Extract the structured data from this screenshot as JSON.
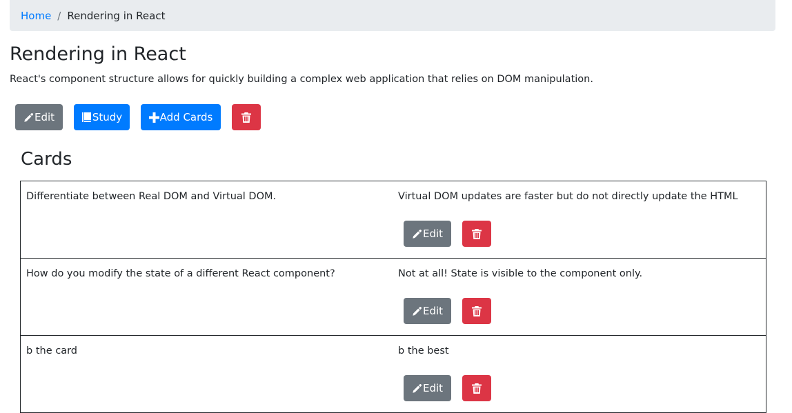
{
  "breadcrumb": {
    "home": "Home",
    "separator": "/",
    "current": "Rendering in React"
  },
  "deck": {
    "title": "Rendering in React",
    "description": "React's component structure allows for quickly building a complex web application that relies on DOM manipulation."
  },
  "toolbar": {
    "edit_label": "Edit",
    "edit_icon": "pencil-icon",
    "study_label": "Study",
    "study_icon": "book-icon",
    "add_label": "Add Cards",
    "add_icon": "plus-icon",
    "delete_icon": "trash-icon"
  },
  "cards_heading": "Cards",
  "cards": [
    {
      "front": "Differentiate between Real DOM and Virtual DOM.",
      "back": "Virtual DOM updates are faster but do not directly update the HTML",
      "edit_label": "Edit"
    },
    {
      "front": "How do you modify the state of a different React component?",
      "back": "Not at all! State is visible to the component only.",
      "edit_label": "Edit"
    },
    {
      "front": "b the card",
      "back": "b the best",
      "edit_label": "Edit"
    }
  ],
  "colors": {
    "primary": "#007bff",
    "secondary": "#6c757d",
    "danger": "#dc3545",
    "breadcrumb_bg": "#e9ecef"
  }
}
